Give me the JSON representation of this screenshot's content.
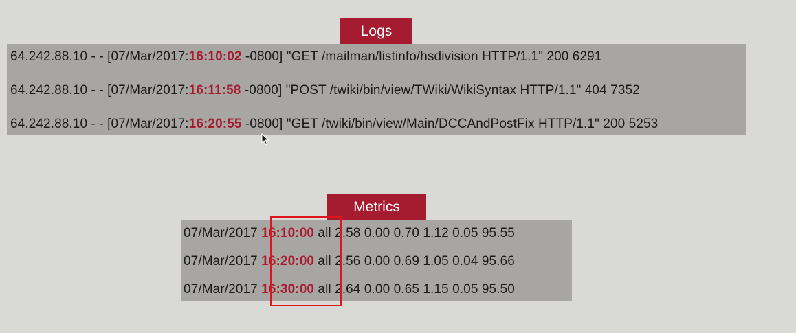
{
  "logs": {
    "title": "Logs",
    "rows": [
      {
        "prefix": "64.242.88.10 - - [07/Mar/2017:",
        "time": "16:10:02",
        "suffix": " -0800] \"GET /mailman/listinfo/hsdivision HTTP/1.1\" 200 6291"
      },
      {
        "prefix": "64.242.88.10 - - [07/Mar/2017:",
        "time": "16:11:58",
        "suffix": " -0800] \"POST /twiki/bin/view/TWiki/WikiSyntax HTTP/1.1\" 404 7352"
      },
      {
        "prefix": "64.242.88.10 - - [07/Mar/2017:",
        "time": "16:20:55",
        "suffix": " -0800] \"GET /twiki/bin/view/Main/DCCAndPostFix HTTP/1.1\" 200 5253"
      }
    ]
  },
  "metrics": {
    "title": "Metrics",
    "rows": [
      {
        "date": "07/Mar/2017 ",
        "time": "16:10:00",
        "values": " all 2.58 0.00 0.70 1.12 0.05 95.55"
      },
      {
        "date": "07/Mar/2017 ",
        "time": "16:20:00",
        "values": " all 2.56 0.00 0.69 1.05 0.04 95.66"
      },
      {
        "date": "07/Mar/2017 ",
        "time": "16:30:00",
        "values": " all 2.64 0.00 0.65 1.15 0.05 95.50"
      }
    ]
  },
  "colors": {
    "background": "#d9d9d6",
    "tag": "#a51c30",
    "panel": "#a8a6a2",
    "time_highlight": "#a51c30",
    "box": "#e0141e"
  }
}
